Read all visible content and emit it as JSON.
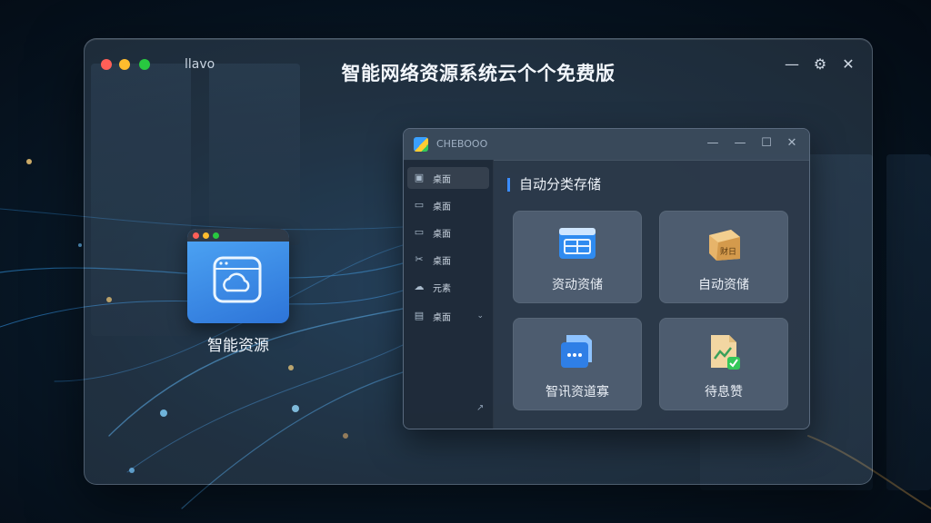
{
  "main_window": {
    "app_label": "llavo",
    "title": "智能网络资源系统云个个免费版",
    "controls": {
      "minimize": "—",
      "settings": "⚙",
      "close": "✕"
    }
  },
  "desktop_icon": {
    "label": "智能资源"
  },
  "inner_window": {
    "title": "CHEBOOO",
    "controls": {
      "minimize": "—",
      "restore": "—",
      "maximize": "☐",
      "close": "✕"
    },
    "sidebar": {
      "items": [
        {
          "label": "桌面",
          "icon": "image-icon"
        },
        {
          "label": "桌面",
          "icon": "folder-icon"
        },
        {
          "label": "桌面",
          "icon": "folder-icon"
        },
        {
          "label": "桌面",
          "icon": "tools-icon"
        },
        {
          "label": "元素",
          "icon": "cloud-icon"
        },
        {
          "label": "桌面",
          "icon": "document-icon"
        }
      ],
      "footer_symbol": "↗"
    },
    "content": {
      "heading": "自动分类存储",
      "cards": [
        {
          "label": "资动资储",
          "icon": "window-app-icon"
        },
        {
          "label": "自动资储",
          "icon": "box-icon"
        },
        {
          "label": "智讯资道寡",
          "icon": "chat-folder-icon"
        },
        {
          "label": "待息赞",
          "icon": "chart-doc-icon"
        }
      ]
    }
  },
  "colors": {
    "accent": "#3a8dff",
    "bg": "#081827"
  }
}
